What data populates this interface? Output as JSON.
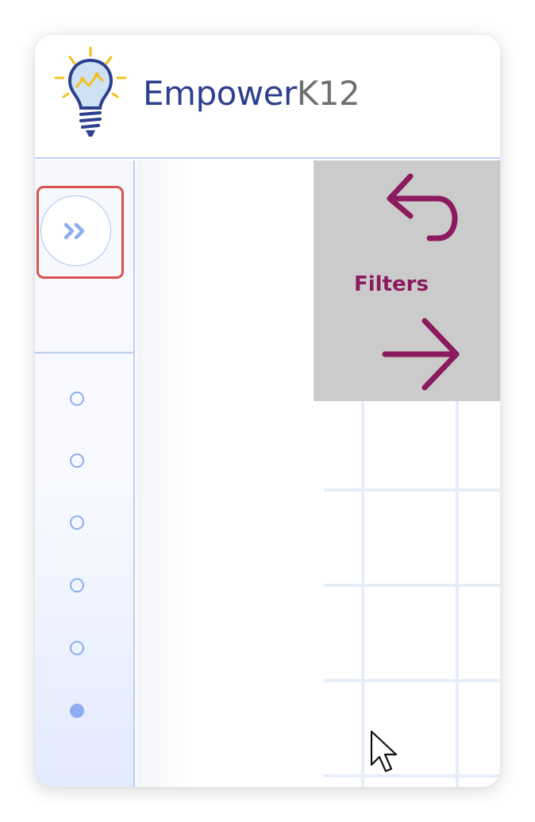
{
  "app": {
    "logo_part1": "Empower",
    "logo_part2": "K12",
    "brand_color": "#2d3f8f",
    "logo_secondary_color": "#6f6f6f",
    "bulb_yellow": "#f2c21b"
  },
  "sidebar": {
    "expand_icon": "double-chevron-right-icon",
    "highlight_color": "#d9534f",
    "accent_color": "#8eadf0",
    "steps": [
      {
        "state": "empty"
      },
      {
        "state": "empty"
      },
      {
        "state": "empty"
      },
      {
        "state": "empty"
      },
      {
        "state": "empty"
      },
      {
        "state": "active"
      }
    ]
  },
  "filters": {
    "label": "Filters",
    "color": "#8b1a5e",
    "panel_color": "#cbcbcb",
    "undo_icon": "undo-icon",
    "apply_icon": "arrow-right-icon"
  }
}
